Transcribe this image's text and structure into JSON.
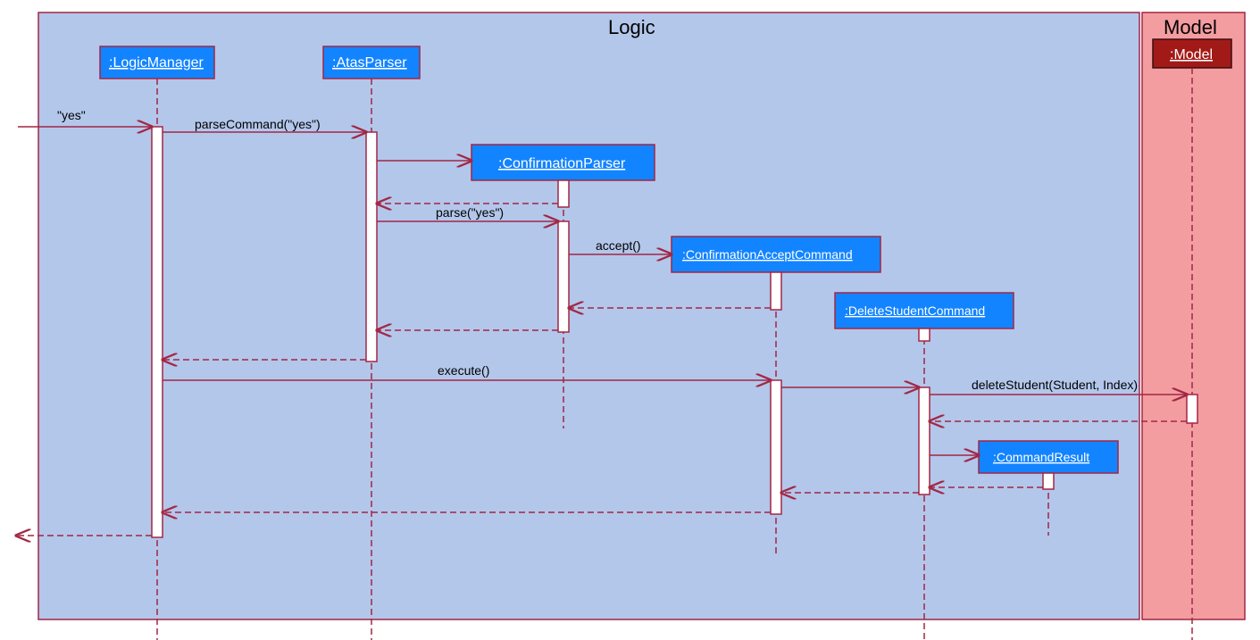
{
  "frames": {
    "logic": {
      "title": "Logic"
    },
    "model": {
      "title": "Model"
    }
  },
  "participants": {
    "logicManager": ":LogicManager",
    "atasParser": ":AtasParser",
    "confirmationParser": ":ConfirmationParser",
    "confirmationAcceptCommand": ":ConfirmationAcceptCommand",
    "deleteStudentCommand": ":DeleteStudentCommand",
    "commandResult": ":CommandResult",
    "model": ":Model"
  },
  "messages": {
    "entry": "\"yes\"",
    "parseCommand": "parseCommand(\"yes\")",
    "parse": "parse(\"yes\")",
    "accept": "accept()",
    "execute": "execute()",
    "deleteStudent": "deleteStudent(Student, Index)"
  }
}
